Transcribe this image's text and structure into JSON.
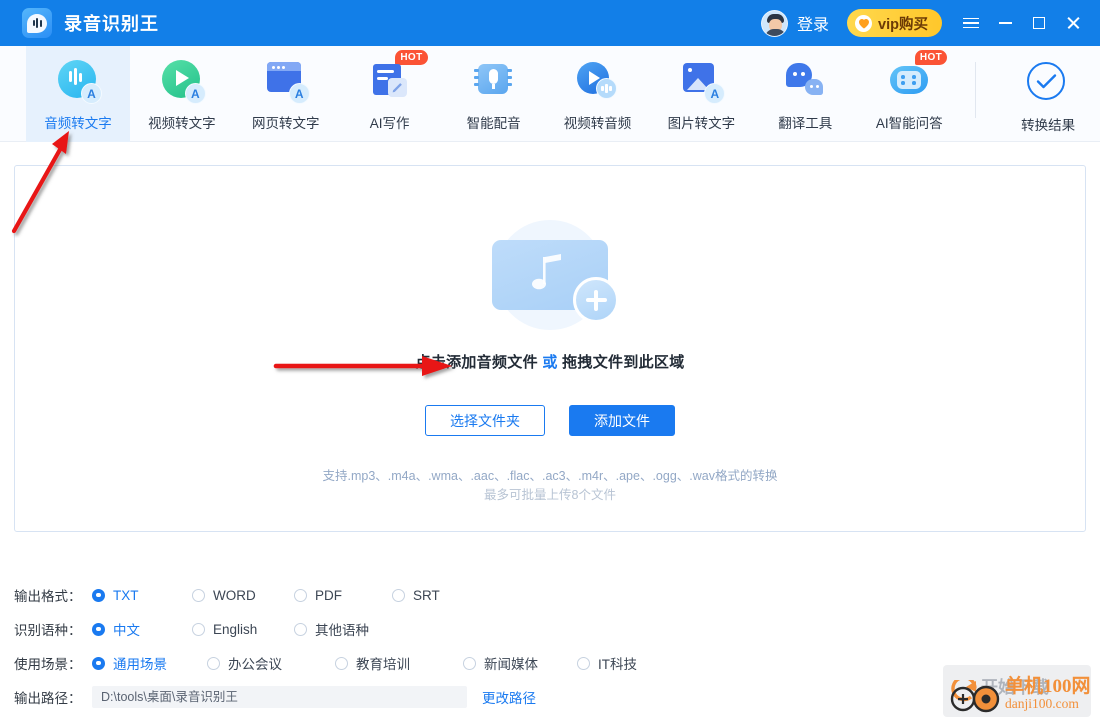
{
  "titlebar": {
    "app_title": "录音识别王",
    "logo_icon": "app-logo-icon",
    "avatar_icon": "user-avatar",
    "login_label": "登录",
    "vip_label": "vip购买",
    "vip_icon": "heart-icon",
    "menu_icon": "hamburger-menu-icon",
    "minimize_icon": "minimize-icon",
    "maximize_icon": "maximize-icon",
    "close_icon": "close-icon",
    "bg_color": "#127fe8",
    "vip_color": "#ffc72b"
  },
  "toolbar": {
    "items": [
      {
        "label": "音频转文字",
        "icon": "audio-to-text-icon",
        "active": true,
        "hot": false
      },
      {
        "label": "视频转文字",
        "icon": "video-to-text-icon",
        "active": false,
        "hot": false
      },
      {
        "label": "网页转文字",
        "icon": "webpage-to-text-icon",
        "active": false,
        "hot": false
      },
      {
        "label": "AI写作",
        "icon": "ai-writing-icon",
        "active": false,
        "hot": true
      },
      {
        "label": "智能配音",
        "icon": "smart-dubbing-icon",
        "active": false,
        "hot": false
      },
      {
        "label": "视频转音频",
        "icon": "video-to-audio-icon",
        "active": false,
        "hot": false
      },
      {
        "label": "图片转文字",
        "icon": "image-to-text-icon",
        "active": false,
        "hot": false
      },
      {
        "label": "翻译工具",
        "icon": "translate-tool-icon",
        "active": false,
        "hot": false
      },
      {
        "label": "AI智能问答",
        "icon": "ai-qa-icon",
        "active": false,
        "hot": true
      }
    ],
    "hot_badge_text": "HOT",
    "result": {
      "label": "转换结果",
      "icon": "check-circle-icon"
    }
  },
  "dropzone": {
    "art_icon": "audio-file-add-icon",
    "main_text_prefix": "点击添加音频文件",
    "main_text_or": "或",
    "main_text_suffix": "拖拽文件到此区域",
    "select_folder_label": "选择文件夹",
    "add_file_label": "添加文件",
    "hint_formats": "支持.mp3、.m4a、.wma、.aac、.flac、.ac3、.m4r、.ape、.ogg、.wav格式的转换",
    "hint_limit": "最多可批量上传8个文件"
  },
  "options": {
    "output_format": {
      "label": "输出格式：",
      "items": [
        {
          "label": "TXT",
          "selected": true
        },
        {
          "label": "WORD",
          "selected": false
        },
        {
          "label": "PDF",
          "selected": false
        },
        {
          "label": "SRT",
          "selected": false
        }
      ]
    },
    "language": {
      "label": "识别语种：",
      "items": [
        {
          "label": "中文",
          "selected": true
        },
        {
          "label": "English",
          "selected": false
        },
        {
          "label": "其他语种",
          "selected": false
        }
      ]
    },
    "scene": {
      "label": "使用场景：",
      "items": [
        {
          "label": "通用场景",
          "selected": true
        },
        {
          "label": "办公会议",
          "selected": false
        },
        {
          "label": "教育培训",
          "selected": false
        },
        {
          "label": "新闻媒体",
          "selected": false
        },
        {
          "label": "IT科技",
          "selected": false
        }
      ]
    },
    "output_path": {
      "label": "输出路径：",
      "value": "D:\\tools\\桌面\\录音识别王",
      "placeholder": "D:\\tools\\桌面\\录音识别王",
      "change_label": "更改路径"
    },
    "accent_color": "#1a7af0"
  },
  "annotations": {
    "arrow1_name": "red-arrow-to-audio-tab",
    "arrow2_name": "red-arrow-to-add-file",
    "arrow_color": "#e81313"
  },
  "watermark": {
    "site_name": "单机100网",
    "site_url": "danji100.com",
    "ghost_text": "开始下载",
    "color": "#f2903a"
  }
}
